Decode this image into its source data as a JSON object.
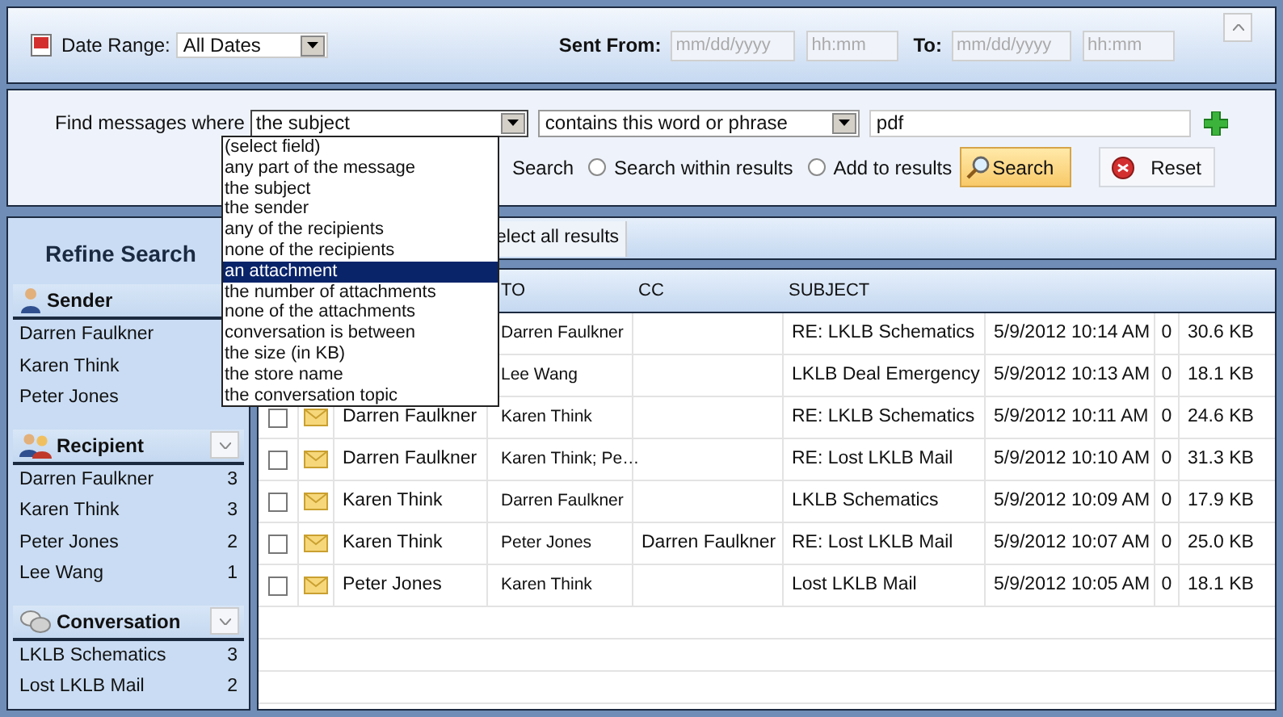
{
  "date_range": {
    "label": "Date Range:",
    "value": "All Dates"
  },
  "sent": {
    "from_label": "Sent From:",
    "from_fields": [
      {
        "placeholder": "mm/dd/yyyy"
      },
      {
        "placeholder": "hh:mm"
      }
    ],
    "to_label": "To:",
    "to_fields": [
      {
        "placeholder": "mm/dd/yyyy"
      },
      {
        "placeholder": "hh:mm"
      }
    ]
  },
  "find": {
    "label": "Find messages where",
    "field": "the subject",
    "condition": "contains this word or phrase",
    "value": "pdf"
  },
  "scope": [
    {
      "label": "Search"
    },
    {
      "label": "Search within results",
      "selected": false
    },
    {
      "label": "Add to results",
      "selected": false
    }
  ],
  "search_button": "Search",
  "reset_button": "Reset",
  "field_options": [
    {
      "label": "(select field)",
      "selected": false
    },
    {
      "label": "any part of the message",
      "selected": false
    },
    {
      "label": "the subject",
      "selected": false
    },
    {
      "label": "the sender",
      "selected": false
    },
    {
      "label": "any of the recipients",
      "selected": false
    },
    {
      "label": "none of the recipients",
      "selected": false
    },
    {
      "label": "an attachment",
      "selected": true
    },
    {
      "label": "the number of attachments",
      "selected": false
    },
    {
      "label": "none of the attachments",
      "selected": false
    },
    {
      "label": "conversation is between",
      "selected": false
    },
    {
      "label": "the size (in KB)",
      "selected": false
    },
    {
      "label": "the store name",
      "selected": false
    },
    {
      "label": "the conversation topic",
      "selected": false
    }
  ],
  "sidebar": {
    "title": "Refine Search",
    "sections": [
      {
        "kind": "sender",
        "title": "Sender",
        "items": [
          {
            "name": "Darren Faulkner"
          },
          {
            "name": "Karen Think"
          },
          {
            "name": "Peter Jones"
          }
        ]
      },
      {
        "kind": "recipient",
        "title": "Recipient",
        "items": [
          {
            "name": "Darren Faulkner",
            "count": "3"
          },
          {
            "name": "Karen Think",
            "count": "3"
          },
          {
            "name": "Peter Jones",
            "count": "2"
          },
          {
            "name": "Lee Wang",
            "count": "1"
          }
        ]
      },
      {
        "kind": "conversation",
        "title": "Conversation",
        "items": [
          {
            "name": "LKLB Schematics",
            "count": "3"
          },
          {
            "name": "Lost LKLB Mail",
            "count": "2"
          }
        ]
      }
    ]
  },
  "toolbar": {
    "select_all": "elect all results"
  },
  "table": {
    "columns": [
      "TO",
      "CC",
      "SUBJECT"
    ],
    "rows": [
      {
        "to": "Darren Faulkner",
        "subject": "RE: LKLB Schematics",
        "date": "5/9/2012 10:14 AM",
        "attachments": "0",
        "size": "30.6 KB"
      },
      {
        "to": "Lee Wang",
        "subject": "LKLB Deal Emergency",
        "date": "5/9/2012 10:13 AM",
        "attachments": "0",
        "size": "18.1 KB"
      },
      {
        "checked": false,
        "from": "Darren Faulkner",
        "to": "Karen Think",
        "subject": "RE: LKLB Schematics",
        "date": "5/9/2012 10:11 AM",
        "attachments": "0",
        "size": "24.6 KB"
      },
      {
        "checked": false,
        "from": "Darren Faulkner",
        "to": "Karen Think; Pe…",
        "subject": "RE: Lost LKLB Mail",
        "date": "5/9/2012 10:10 AM",
        "attachments": "0",
        "size": "31.3 KB"
      },
      {
        "checked": false,
        "from": "Karen Think",
        "to": "Darren Faulkner",
        "subject": "LKLB Schematics",
        "date": "5/9/2012 10:09 AM",
        "attachments": "0",
        "size": "17.9 KB"
      },
      {
        "checked": false,
        "from": "Karen Think",
        "to": "Peter Jones",
        "cc": "Darren Faulkner",
        "subject": "RE: Lost LKLB Mail",
        "date": "5/9/2012 10:07 AM",
        "attachments": "0",
        "size": "25.0 KB"
      },
      {
        "checked": false,
        "from": "Peter Jones",
        "to": "Karen Think",
        "subject": "Lost LKLB Mail",
        "date": "5/9/2012 10:05 AM",
        "attachments": "0",
        "size": "18.1 KB"
      }
    ]
  }
}
